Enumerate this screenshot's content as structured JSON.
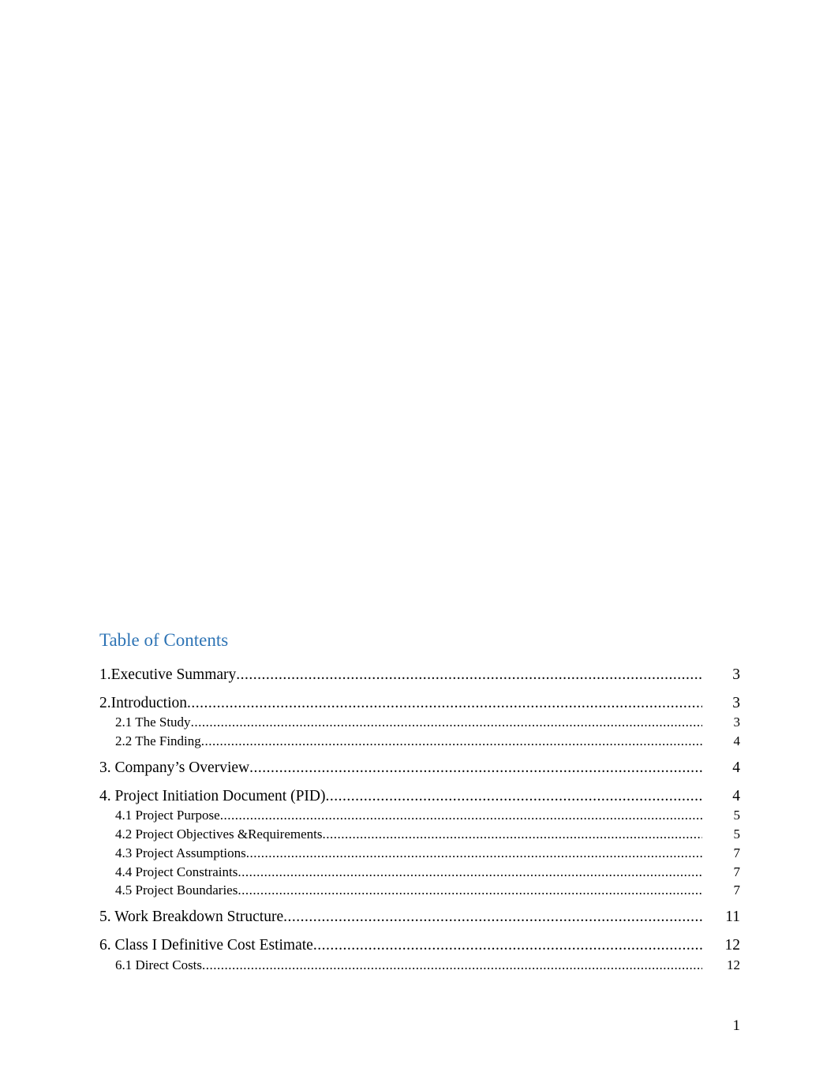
{
  "toc": {
    "title": "Table of Contents",
    "entries": [
      {
        "label": "1.Executive Summary",
        "page": "3",
        "level": 1
      },
      {
        "label": "2.Introduction ",
        "page": "3",
        "level": 1
      },
      {
        "label": "2.1 The Study",
        "page": "3",
        "level": 2
      },
      {
        "label": "2.2 The Finding",
        "page": "4",
        "level": 2
      },
      {
        "label": "3. Company’s Overview",
        "page": "4",
        "level": 1
      },
      {
        "label": "4. Project Initiation Document (PID)",
        "page": "4",
        "level": 1
      },
      {
        "label": "4.1 Project Purpose ",
        "page": "5",
        "level": 2
      },
      {
        "label": "4.2 Project Objectives &Requirements  ",
        "page": "5",
        "level": 2
      },
      {
        "label": "4.3 Project Assumptions ",
        "page": "7",
        "level": 2
      },
      {
        "label": "4.4 Project Constraints ",
        "page": "7",
        "level": 2
      },
      {
        "label": "4.5 Project Boundaries ",
        "page": "7",
        "level": 2
      },
      {
        "label": "5. Work Breakdown Structure  ",
        "page": "11",
        "level": 1
      },
      {
        "label": "6. Class I Definitive Cost Estimate",
        "page": "12",
        "level": 1
      },
      {
        "label": "6.1 Direct Costs",
        "page": "12",
        "level": 2
      }
    ]
  },
  "footer": {
    "page_number": "1"
  }
}
